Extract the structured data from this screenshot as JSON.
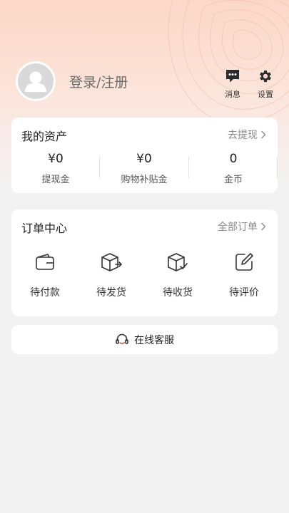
{
  "header": {
    "login_text": "登录/注册",
    "messages_label": "消息",
    "settings_label": "设置",
    "icons": {
      "avatar": "default-avatar-icon",
      "messages": "chat-bubble-icon",
      "settings": "gear-icon"
    },
    "colors": {
      "gradient_top": "#fbd7c7",
      "background": "#f3f2f2"
    }
  },
  "assets": {
    "title": "我的资产",
    "link_label": "去提现",
    "items": [
      {
        "value": "¥0",
        "label": "提现金"
      },
      {
        "value": "¥0",
        "label": "购物补贴金"
      },
      {
        "value": "0",
        "label": "金币"
      }
    ]
  },
  "orders": {
    "title": "订单中心",
    "link_label": "全部订单",
    "items": [
      {
        "label": "待付款",
        "icon": "wallet-icon"
      },
      {
        "label": "待发货",
        "icon": "box-arrow-icon"
      },
      {
        "label": "待收货",
        "icon": "box-check-icon"
      },
      {
        "label": "待评价",
        "icon": "edit-icon"
      }
    ]
  },
  "service": {
    "label": "在线客服",
    "icon": "headset-icon"
  }
}
